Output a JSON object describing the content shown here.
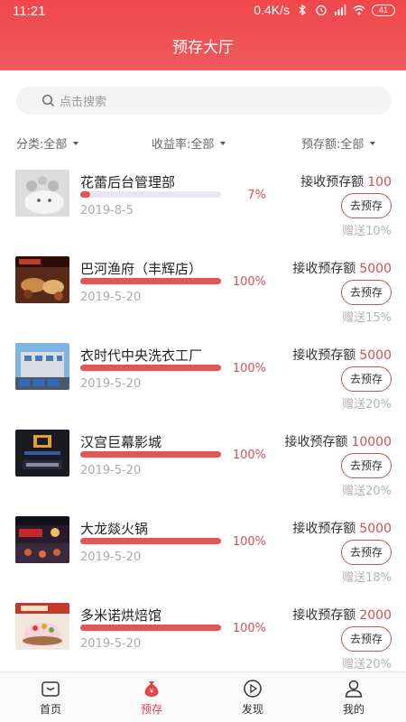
{
  "status": {
    "time": "11:21",
    "speed": "0.4K/s",
    "battery": "41"
  },
  "header": {
    "title": "预存大厅"
  },
  "search": {
    "placeholder": "点击搜索"
  },
  "filters": [
    {
      "label": "分类:全部"
    },
    {
      "label": "收益率:全部"
    },
    {
      "label": "预存额:全部"
    }
  ],
  "items": [
    {
      "name": "花蕾后台管理部",
      "progress": 0.07,
      "pct": "7%",
      "date": "2019-8-5",
      "label": "接收预存额",
      "amount": "100",
      "button": "去预存",
      "bonus": "赠送10%"
    },
    {
      "name": "巴河渔府（丰辉店）",
      "progress": 1.0,
      "pct": "100%",
      "date": "2019-5-20",
      "label": "接收预存额",
      "amount": "5000",
      "button": "去预存",
      "bonus": "赠送15%"
    },
    {
      "name": "衣时代中央洗衣工厂",
      "progress": 1.0,
      "pct": "100%",
      "date": "2019-5-20",
      "label": "接收预存额",
      "amount": "5000",
      "button": "去预存",
      "bonus": "赠送20%"
    },
    {
      "name": "汉宫巨幕影城",
      "progress": 1.0,
      "pct": "100%",
      "date": "2019-5-20",
      "label": "接收预存额",
      "amount": "10000",
      "button": "去预存",
      "bonus": "赠送20%"
    },
    {
      "name": "大龙燚火锅",
      "progress": 1.0,
      "pct": "100%",
      "date": "2019-5-20",
      "label": "接收预存额",
      "amount": "5000",
      "button": "去预存",
      "bonus": "赠送18%"
    },
    {
      "name": "多米诺烘焙馆",
      "progress": 1.0,
      "pct": "100%",
      "date": "2019-5-20",
      "label": "接收预存额",
      "amount": "2000",
      "button": "去预存",
      "bonus": "赠送20%"
    }
  ],
  "tabs": [
    {
      "label": "首页",
      "icon": "home-icon"
    },
    {
      "label": "预存",
      "icon": "money-bag-icon",
      "active": true
    },
    {
      "label": "发现",
      "icon": "play-circle-icon"
    },
    {
      "label": "我的",
      "icon": "user-icon"
    }
  ],
  "colors": {
    "accent": "#e0464a",
    "header": "#f0474b",
    "progress": "#e05555",
    "amount": "#c85252"
  }
}
